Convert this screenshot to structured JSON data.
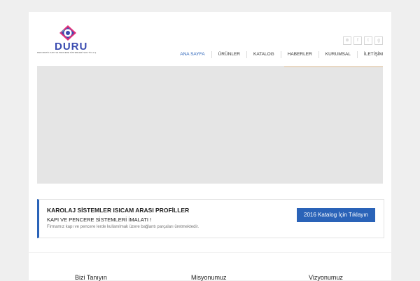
{
  "brand": {
    "name": "DURU",
    "tagline": "DEKORATİF KAPI VE PENCERE SİSTEMLERİ SAN.TİC.A.Ş.",
    "accent": "#2a63b8"
  },
  "social": [
    "rss-icon",
    "facebook-icon",
    "twitter-icon",
    "google-plus-icon"
  ],
  "nav": {
    "items": [
      {
        "label": "ANA SAYFA",
        "active": true
      },
      {
        "label": "ÜRÜNLER"
      },
      {
        "label": "KATALOG"
      },
      {
        "label": "HABERLER"
      },
      {
        "label": "KURUMSAL"
      },
      {
        "label": "İLETİŞİM"
      }
    ]
  },
  "promo": {
    "title": "KAROLAJ SİSTEMLER ISICAM ARASI PROFİLLER",
    "subtitle": "KAPI VE PENCERE SİSTEMLERİ İMALATI !",
    "description": "Firmamız kapı ve pencere lerde kullanılmak üzere bağlantı parçaları üretmektedir.",
    "button": "2016 Katalog İçin Tıklayın"
  },
  "sections": {
    "about": "Bizi Tanıyın",
    "mission": "Misyonumuz",
    "vision": "Vizyonumuz"
  }
}
